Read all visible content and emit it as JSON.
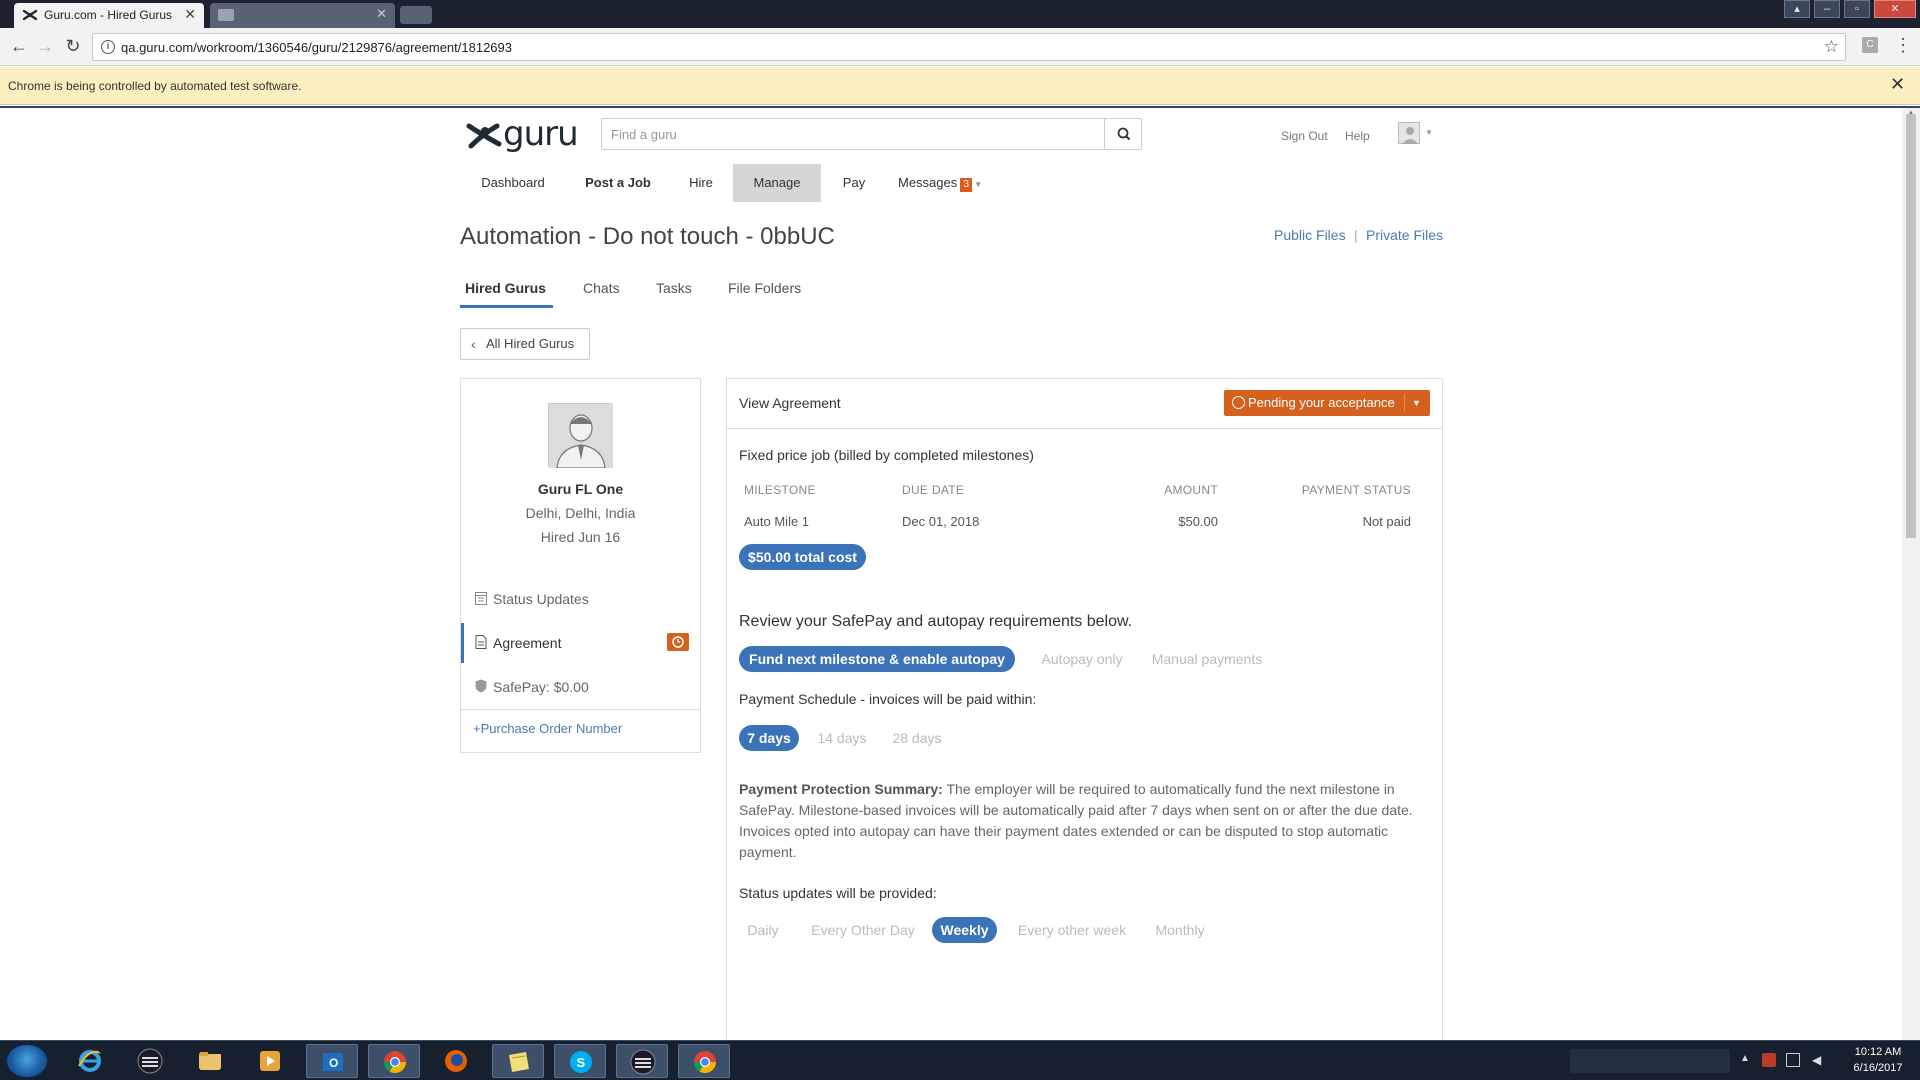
{
  "browser": {
    "active_tab_title": "Guru.com - Hired Gurus",
    "url": "qa.guru.com/workroom/1360546/guru/2129876/agreement/1812693",
    "infobar_text": "Chrome is being controlled by automated test software.",
    "ext_label": "C"
  },
  "header": {
    "logo_text": "guru",
    "search_placeholder": "Find a guru",
    "sign_out": "Sign Out",
    "help": "Help"
  },
  "nav": {
    "dashboard": "Dashboard",
    "post_job": "Post a Job",
    "hire": "Hire",
    "manage": "Manage",
    "pay": "Pay",
    "messages": "Messages",
    "messages_count": "3"
  },
  "page": {
    "title": "Automation - Do not touch - 0bbUC",
    "public_files": "Public Files",
    "files_separator": "|",
    "private_files": "Private Files"
  },
  "subtabs": {
    "hired_gurus": "Hired Gurus",
    "chats": "Chats",
    "tasks": "Tasks",
    "file_folders": "File Folders"
  },
  "back_button": "All Hired Gurus",
  "guru": {
    "name": "Guru FL One",
    "location": "Delhi, Delhi, India",
    "hired": "Hired Jun 16",
    "status_updates": "Status Updates",
    "agreement": "Agreement",
    "safepay": "SafePay: $0.00",
    "po_link": "+Purchase Order Number"
  },
  "agreement": {
    "header": "View Agreement",
    "pending": "Pending your acceptance",
    "job_type": "Fixed price job (billed by completed milestones)",
    "columns": [
      "MILESTONE",
      "DUE DATE",
      "AMOUNT",
      "PAYMENT STATUS"
    ],
    "rows": [
      {
        "milestone": "Auto Mile 1",
        "due_date": "Dec 01, 2018",
        "amount": "$50.00",
        "status": "Not paid"
      }
    ],
    "total_cost": "$50.00 total cost",
    "review_heading": "Review your SafePay and autopay requirements below.",
    "safepay_options": [
      "Fund next milestone & enable autopay",
      "Autopay only",
      "Manual payments"
    ],
    "safepay_selected": "Fund next milestone & enable autopay",
    "schedule_heading": "Payment Schedule - invoices will be paid within:",
    "schedule_options": [
      "7 days",
      "14 days",
      "28 days"
    ],
    "schedule_selected": "7 days",
    "summary_label": "Payment Protection Summary:",
    "summary_text": " The employer will be required to automatically fund the next milestone in SafePay. Milestone-based invoices will be automatically paid after 7 days when sent on or after the due date. Invoices opted into autopay can have their payment dates extended or can be disputed to stop automatic payment.",
    "updates_heading": "Status updates will be provided:",
    "updates_options": [
      "Daily",
      "Every Other Day",
      "Weekly",
      "Every other week",
      "Monthly"
    ],
    "updates_selected": "Weekly"
  },
  "taskbar": {
    "icons": [
      "ie-icon",
      "terminal-icon",
      "folder-icon",
      "media-player-icon",
      "outlook-icon",
      "chrome-icon",
      "firefox-icon",
      "notes-icon",
      "skype-icon",
      "terminal-icon",
      "chrome-icon"
    ],
    "time": "10:12 AM",
    "date": "6/16/2017"
  },
  "colors": {
    "brand_blue": "#3b73b9",
    "link_blue": "#4a7ab3",
    "pending_orange": "#d5611f",
    "infobar_yellow": "#fbeebf"
  }
}
